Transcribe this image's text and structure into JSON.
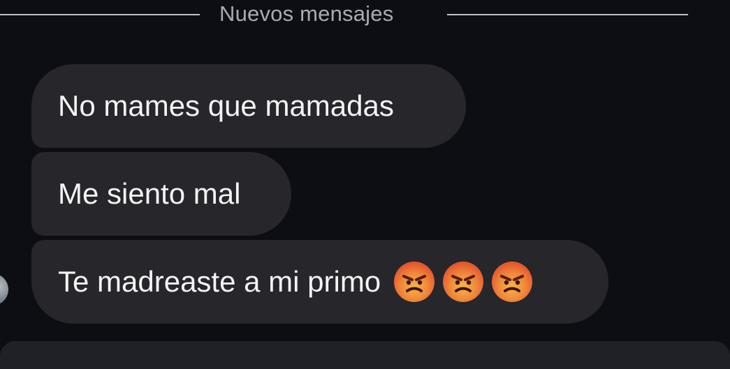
{
  "divider": {
    "label": "Nuevos mensajes"
  },
  "messages": [
    {
      "text": "No mames que mamadas"
    },
    {
      "text": "Me siento mal"
    },
    {
      "text": "Te madreaste a mi primo",
      "emojis": [
        "angry-face-icon",
        "angry-face-icon",
        "angry-face-icon"
      ]
    }
  ],
  "colors": {
    "background": "#0d0e14",
    "bubble": "#26262b",
    "text": "#f4f4f6",
    "divider_text": "#a8abb2",
    "divider_line": "#cfd1d6",
    "emoji_outer": "#e4572f",
    "emoji_inner": "#f5b547"
  }
}
